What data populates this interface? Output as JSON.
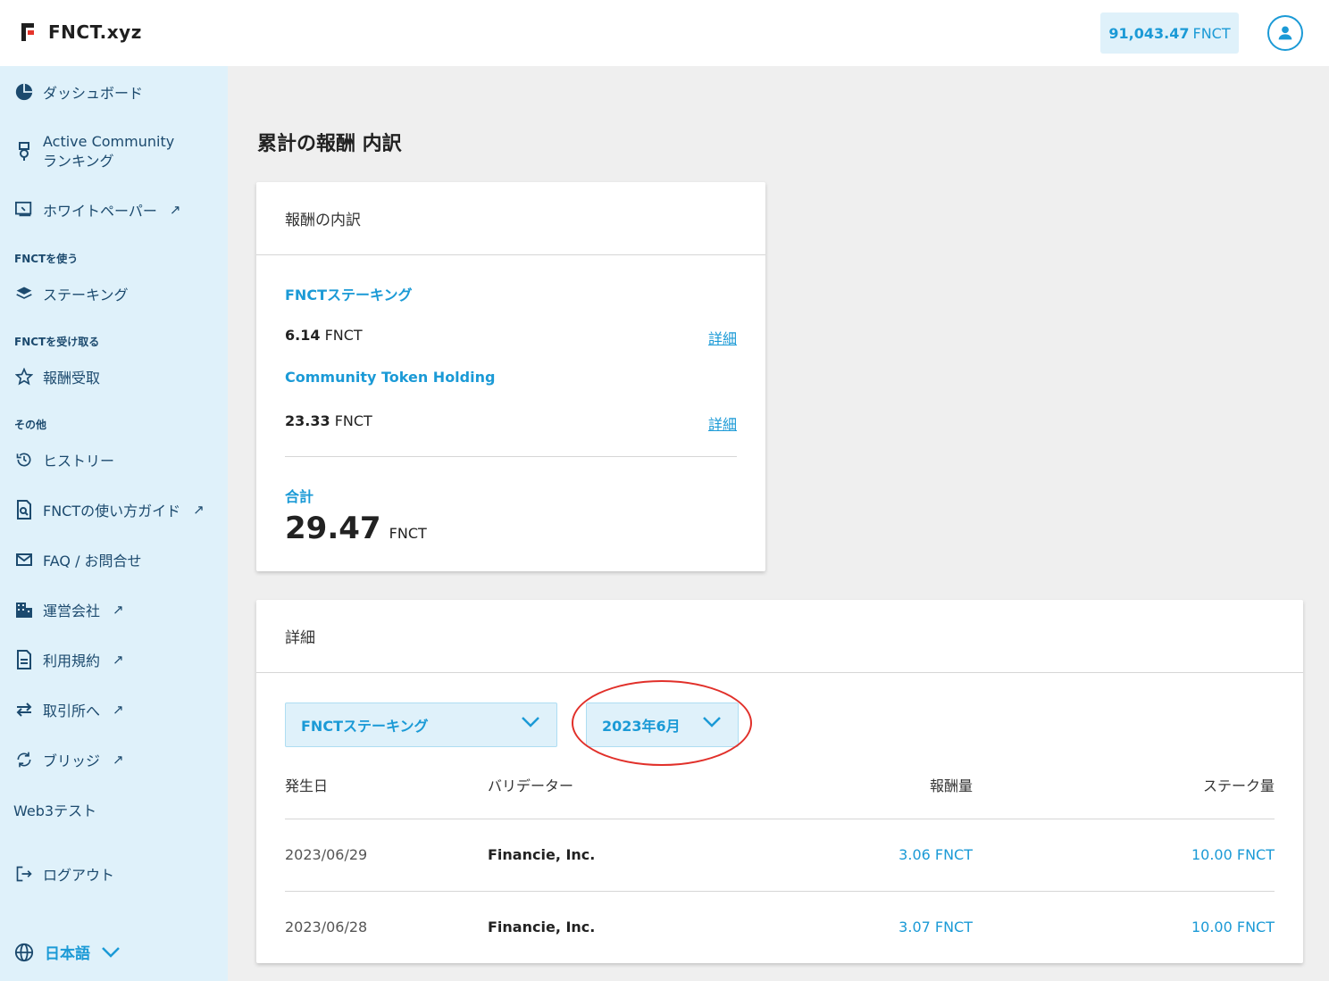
{
  "header": {
    "logo_text": "FNCT.xyz",
    "balance_value": "91,043.47",
    "balance_unit": "FNCT"
  },
  "sidebar": {
    "items": [
      {
        "label": "ダッシュボード"
      },
      {
        "label_line1": "Active Community",
        "label_line2": "ランキング"
      },
      {
        "label": "ホワイトペーパー"
      },
      {
        "label": "ステーキング"
      },
      {
        "label": "報酬受取"
      },
      {
        "label": "ヒストリー"
      },
      {
        "label": "FNCTの使い方ガイド"
      },
      {
        "label": "FAQ / お問合せ"
      },
      {
        "label": "運営会社"
      },
      {
        "label": "利用規約"
      },
      {
        "label": "取引所へ"
      },
      {
        "label": "ブリッジ"
      },
      {
        "label": "Web3テスト"
      },
      {
        "label": "ログアウト"
      }
    ],
    "sections": {
      "use": "FNCTを使う",
      "receive": "FNCTを受け取る",
      "other": "その他"
    },
    "external_mark": "↗",
    "language": "日本語"
  },
  "main": {
    "page_title": "累計の報酬 内訳",
    "breakdown": {
      "heading": "報酬の内訳",
      "items": [
        {
          "label": "FNCTステーキング",
          "amount": "6.14",
          "unit": "FNCT",
          "link": "詳細"
        },
        {
          "label": "Community Token Holding",
          "amount": "23.33",
          "unit": "FNCT",
          "link": "詳細"
        }
      ],
      "total_label": "合計",
      "total_amount": "29.47",
      "total_unit": "FNCT"
    },
    "details": {
      "heading": "詳細",
      "filter_type": "FNCTステーキング",
      "filter_month": "2023年6月",
      "columns": [
        "発生日",
        "バリデーター",
        "報酬量",
        "ステーク量"
      ],
      "rows": [
        {
          "date": "2023/06/29",
          "validator": "Financie, Inc.",
          "reward": "3.06 FNCT",
          "stake": "10.00 FNCT"
        },
        {
          "date": "2023/06/28",
          "validator": "Financie, Inc.",
          "reward": "3.07 FNCT",
          "stake": "10.00 FNCT"
        }
      ]
    }
  },
  "colors": {
    "accent": "#1b9ad6",
    "sidebar_bg": "#dff1fa",
    "nav_text": "#1c4a6e",
    "highlight": "#e1302a"
  }
}
